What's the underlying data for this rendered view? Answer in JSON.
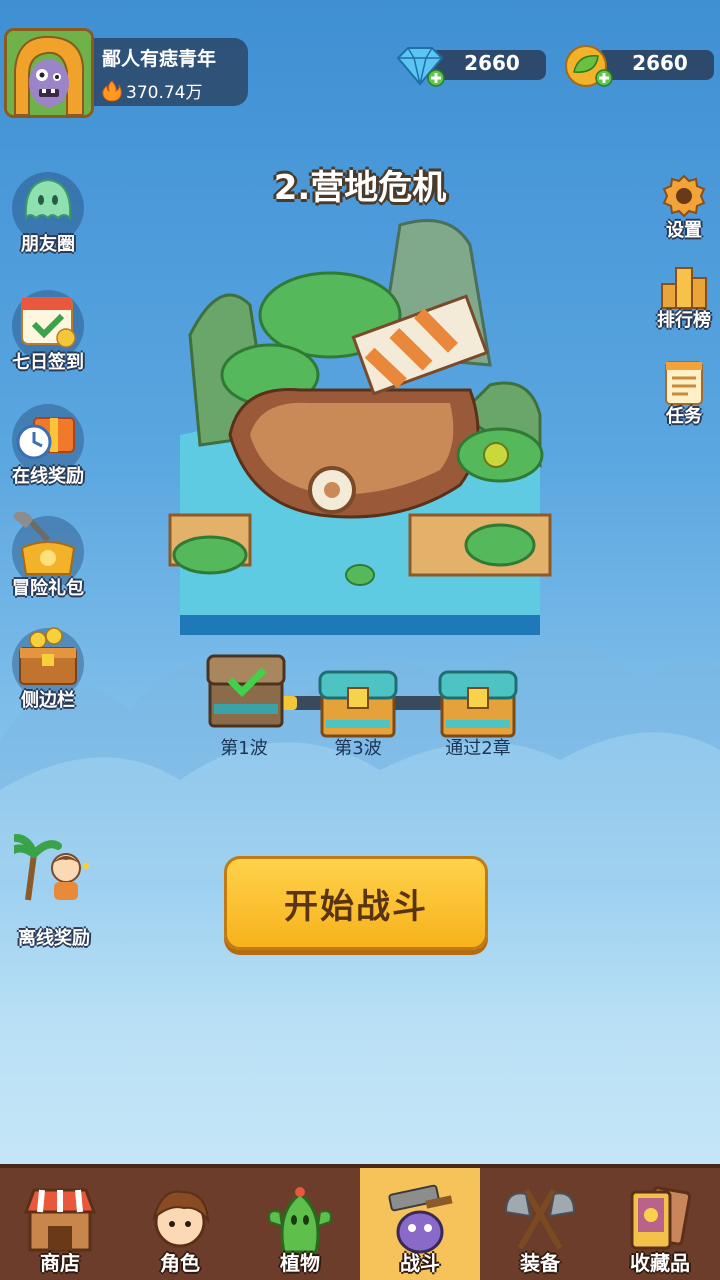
{
  "profile": {
    "name": "鄙人有痣青年",
    "power": "370.74万"
  },
  "currencies": [
    {
      "icon": "diamond-icon",
      "value": "2660"
    },
    {
      "icon": "leaf-coin-icon",
      "value": "2660"
    }
  ],
  "left_menu": [
    {
      "label": "朋友圈",
      "icon": "ghost-icon"
    },
    {
      "label": "七日签到",
      "icon": "calendar-check-icon"
    },
    {
      "label": "在线奖励",
      "icon": "clock-gift-icon"
    },
    {
      "label": "冒险礼包",
      "icon": "gift-bag-icon"
    },
    {
      "label": "侧边栏",
      "icon": "treasure-box-icon"
    },
    {
      "label": "离线奖励",
      "icon": "character-palm-icon"
    }
  ],
  "right_menu": [
    {
      "label": "设置",
      "icon": "gear-icon"
    },
    {
      "label": "排行榜",
      "icon": "podium-icon"
    },
    {
      "label": "任务",
      "icon": "scroll-icon"
    }
  ],
  "level": {
    "title": "2.营地危机"
  },
  "waves": [
    {
      "label": "第1波",
      "state": "claimed"
    },
    {
      "label": "第3波",
      "state": "locked"
    },
    {
      "label": "通过2章",
      "state": "locked"
    }
  ],
  "wave_progress": 0.15,
  "start_button": {
    "label": "开始战斗"
  },
  "nav": [
    {
      "label": "商店",
      "icon": "shop-icon",
      "active": false
    },
    {
      "label": "角色",
      "icon": "character-icon",
      "active": false
    },
    {
      "label": "植物",
      "icon": "cactus-icon",
      "active": false
    },
    {
      "label": "战斗",
      "icon": "battle-icon",
      "active": true
    },
    {
      "label": "装备",
      "icon": "axes-icon",
      "active": false
    },
    {
      "label": "收藏品",
      "icon": "cards-icon",
      "active": false
    }
  ],
  "colors": {
    "accent": "#f7b21c",
    "nav_bg": "#6b3d2a",
    "nav_active": "#f6c35a"
  }
}
